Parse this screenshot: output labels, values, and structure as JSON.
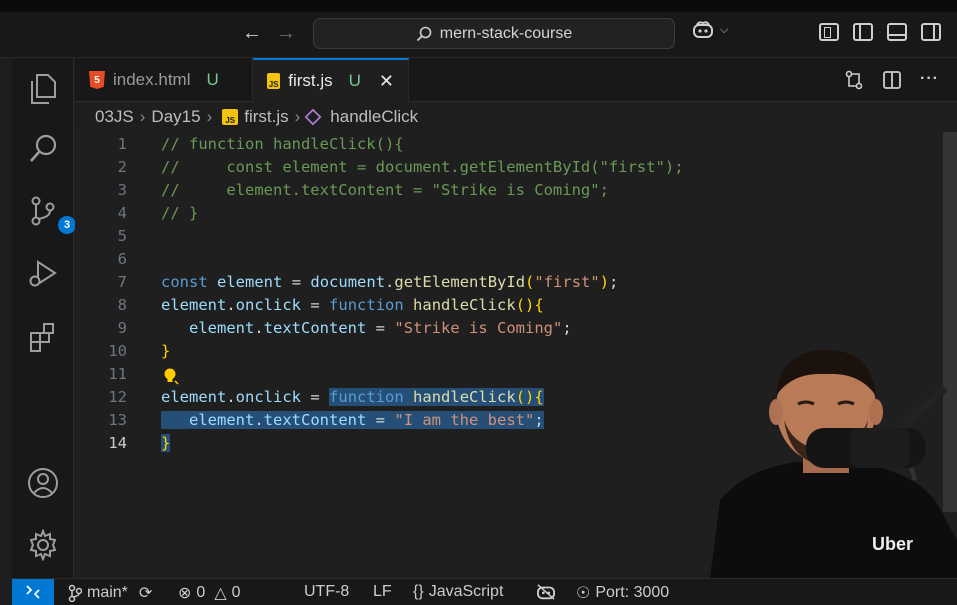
{
  "titlebar": {
    "search_text": "mern-stack-course"
  },
  "activity_bar": {
    "source_control_badge": "3"
  },
  "tabs": [
    {
      "label": "index.html",
      "status": "U"
    },
    {
      "label": "first.js",
      "status": "U"
    }
  ],
  "breadcrumb": {
    "folder1": "03JS",
    "folder2": "Day15",
    "file": "first.js",
    "symbol": "handleClick"
  },
  "editor": {
    "line_numbers": [
      "1",
      "2",
      "3",
      "4",
      "5",
      "6",
      "7",
      "8",
      "9",
      "10",
      "11",
      "12",
      "13",
      "14"
    ],
    "active_line": "14"
  },
  "statusbar": {
    "branch": "main*",
    "errors": "0",
    "warnings": "0",
    "encoding": "UTF-8",
    "eol": "LF",
    "language": "JavaScript",
    "port": "Port: 3000"
  },
  "webcam": {
    "shirt_text": "Uber"
  },
  "colors": {
    "accent": "#0078d4",
    "comment": "#6a9955",
    "keyword": "#569cd6",
    "string": "#ce9178",
    "selection": "#264f78"
  }
}
